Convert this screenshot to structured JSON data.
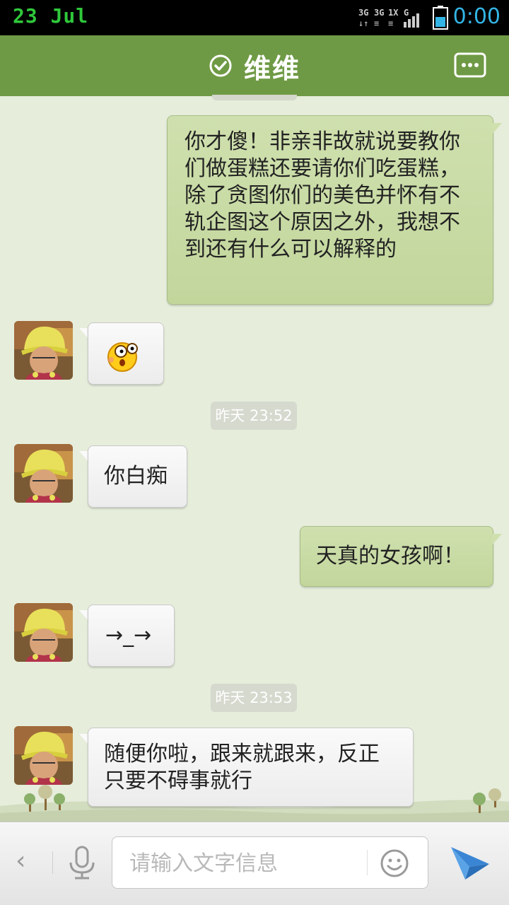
{
  "status_bar": {
    "date": "23  Jul",
    "network": "3G 3G 1X G",
    "time": "0:00"
  },
  "header": {
    "title": "维维",
    "verified_icon": "check-circle-icon",
    "menu_icon": "chat-menu-icon"
  },
  "messages": [
    {
      "direction": "out",
      "text": "你才傻！非亲非故就说要教你们做蛋糕还要请你们吃蛋糕，除了贪图你们的美色并怀有不轨企图这个原因之外，我想不到还有什么可以解释的"
    },
    {
      "direction": "in",
      "type": "emoji",
      "emoji": "surprised-emoji"
    },
    {
      "type": "timestamp",
      "text": "昨天 23:52"
    },
    {
      "direction": "in",
      "text": "你白痴"
    },
    {
      "direction": "out",
      "text": "天真的女孩啊！"
    },
    {
      "direction": "in",
      "text": "→_→"
    },
    {
      "type": "timestamp",
      "text": "昨天 23:53"
    },
    {
      "direction": "in",
      "text": "随便你啦，跟来就跟来，反正只要不碍事就行"
    }
  ],
  "input_bar": {
    "placeholder": "请输入文字信息",
    "value": ""
  },
  "colors": {
    "header": "#6f9a45",
    "chat_background": "#e6eddb",
    "bubble_out": "#c8dba4",
    "bubble_in": "#f3f3f3",
    "status_date": "#2fc83b",
    "status_time": "#33b5e5",
    "send_icon": "#3a86d4"
  }
}
